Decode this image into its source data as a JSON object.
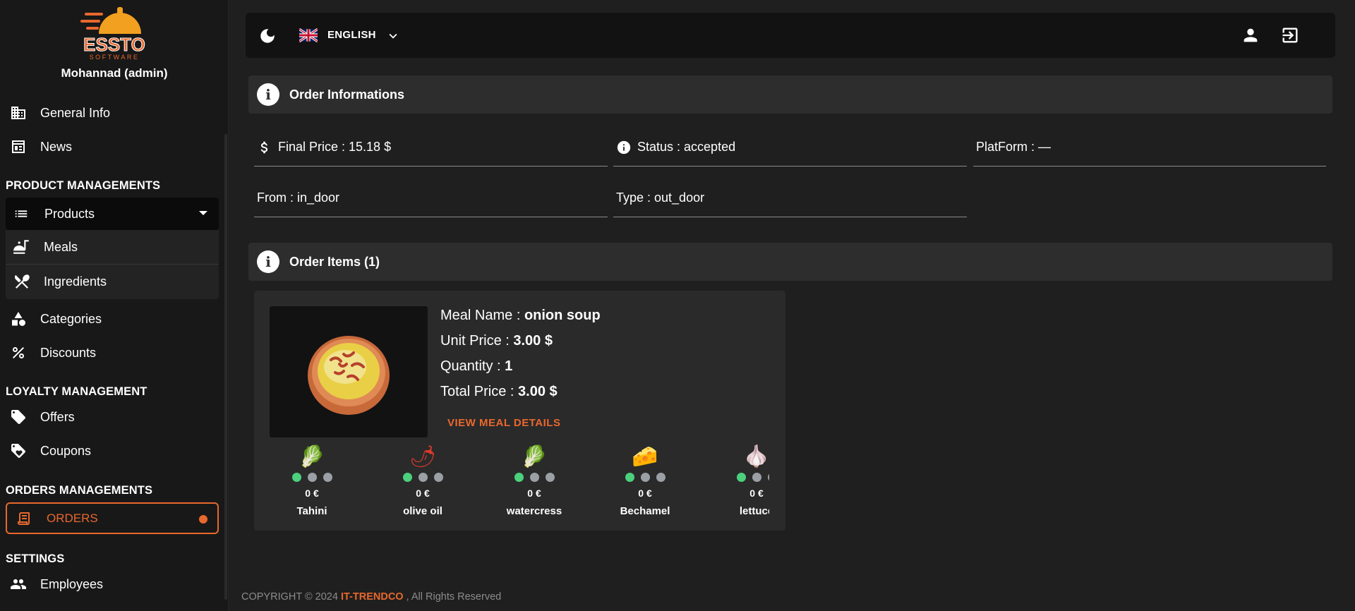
{
  "sidebar": {
    "logo_text": "ESSTO",
    "logo_sub": "SOFTWARE",
    "user": "Mohannad (admin)",
    "general_info": "General Info",
    "news": "News",
    "product_section": "PRODUCT MANAGEMENTS",
    "products": "Products",
    "meals": "Meals",
    "ingredients": "Ingredients",
    "categories": "Categories",
    "discounts": "Discounts",
    "loyalty_section": "LOYALTY MANAGEMENT",
    "offers": "Offers",
    "coupons": "Coupons",
    "orders_section": "ORDERS MANAGEMENTS",
    "orders": "ORDERS",
    "settings_section": "SETTINGS",
    "employees": "Employees"
  },
  "topbar": {
    "language": "ENGLISH"
  },
  "order_info": {
    "title": "Order Informations",
    "final_price": "Final Price : 15.18 $",
    "status": "Status : accepted",
    "platform": "PlatForm : —",
    "from": "From : in_door",
    "type": "Type : out_door"
  },
  "order_items": {
    "title": "Order Items (1)",
    "meal_name_label": "Meal Name : ",
    "meal_name": "onion soup",
    "unit_price_label": "Unit Price : ",
    "unit_price": "3.00 $",
    "quantity_label": "Quantity : ",
    "quantity": "1",
    "total_price_label": "Total Price : ",
    "total_price": "3.00 $",
    "view_details": "VIEW MEAL DETAILS",
    "ingredients": [
      {
        "name": "Tahini",
        "price": "0 €",
        "icon": "🥬"
      },
      {
        "name": "olive oil",
        "price": "0 €",
        "icon": "🌶"
      },
      {
        "name": "watercress",
        "price": "0 €",
        "icon": "🥬"
      },
      {
        "name": "Bechamel",
        "price": "0 €",
        "icon": "🧀"
      },
      {
        "name": "lettuce",
        "price": "0 €",
        "icon": "🧄"
      }
    ]
  },
  "footer": {
    "prefix": "COPYRIGHT © 2024 ",
    "brand": "IT-TRENDCO",
    "suffix": " , All Rights Reserved"
  },
  "colors": {
    "accent": "#e8682d",
    "dot_on": "#4cd07d",
    "dot_off": "#9aa0a6"
  }
}
